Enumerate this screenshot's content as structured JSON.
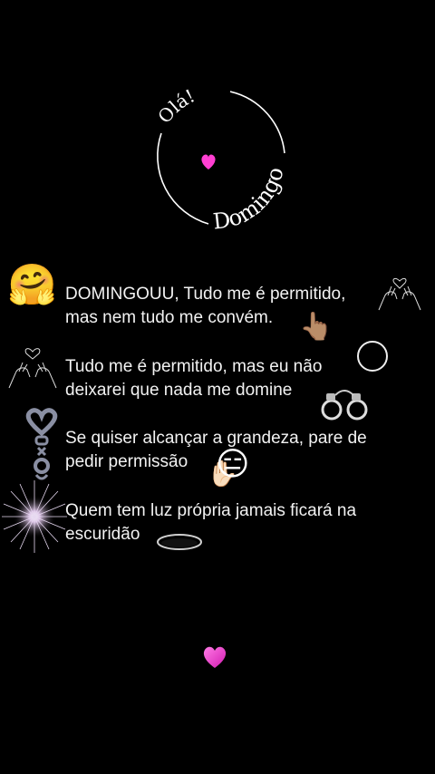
{
  "emblem": {
    "greeting": "Olá!",
    "day": "Domingo",
    "heart_color": "#ff3fd2"
  },
  "lines": [
    {
      "text_1": "DOMINGOUU, Tudo me é permitido,",
      "text_2": "mas nem tudo me convém."
    },
    {
      "text_1": "Tudo me é permitido, mas eu não",
      "text_2": "deixarei que nada me domine"
    },
    {
      "text_1": "Se quiser alcançar a grandeza, pare de",
      "text_2": "pedir permissão"
    },
    {
      "text_1": "Quem tem luz própria jamais ficará na",
      "text_2": "escuridão"
    }
  ],
  "icons": {
    "hug": "hugging-face-emoji-icon",
    "hands_heart_right": "hands-heart-lineart-icon",
    "hands_heart_left": "hands-heart-lineart-icon",
    "pointing": "pointing-hand-emoji-icon",
    "ring": "circle-ring-icon",
    "handcuffs": "handcuffs-icon",
    "chrome_heart": "chrome-heart-chain-icon",
    "stop_face": "raised-hand-face-emoji-icon",
    "sparkle": "sparkle-light-icon",
    "hole": "dark-hole-icon",
    "heart": "pink-heart-icon"
  }
}
